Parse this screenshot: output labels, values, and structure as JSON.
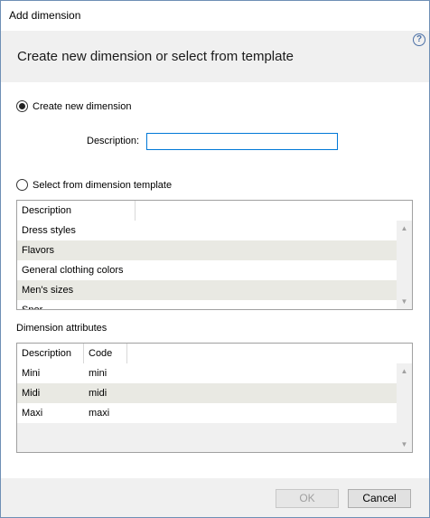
{
  "window": {
    "title": "Add dimension"
  },
  "header": {
    "heading": "Create new dimension or select from template",
    "help_icon": "?"
  },
  "create_new": {
    "label": "Create new dimension",
    "selected": true
  },
  "description_field": {
    "label": "Description:",
    "value": ""
  },
  "template": {
    "label": "Select from dimension template",
    "selected": false,
    "columns": [
      "Description"
    ],
    "rows": [
      "Dress styles",
      "Flavors",
      "General clothing colors",
      "Men's sizes",
      "Spor..."
    ]
  },
  "attributes": {
    "label": "Dimension attributes",
    "columns": [
      "Description",
      "Code"
    ],
    "rows": [
      {
        "description": "Mini",
        "code": "mini"
      },
      {
        "description": "Midi",
        "code": "midi"
      },
      {
        "description": "Maxi",
        "code": "maxi"
      }
    ]
  },
  "footer": {
    "ok_label": "OK",
    "cancel_label": "Cancel"
  },
  "scroll_arrows": {
    "up": "▲",
    "down": "▼"
  }
}
